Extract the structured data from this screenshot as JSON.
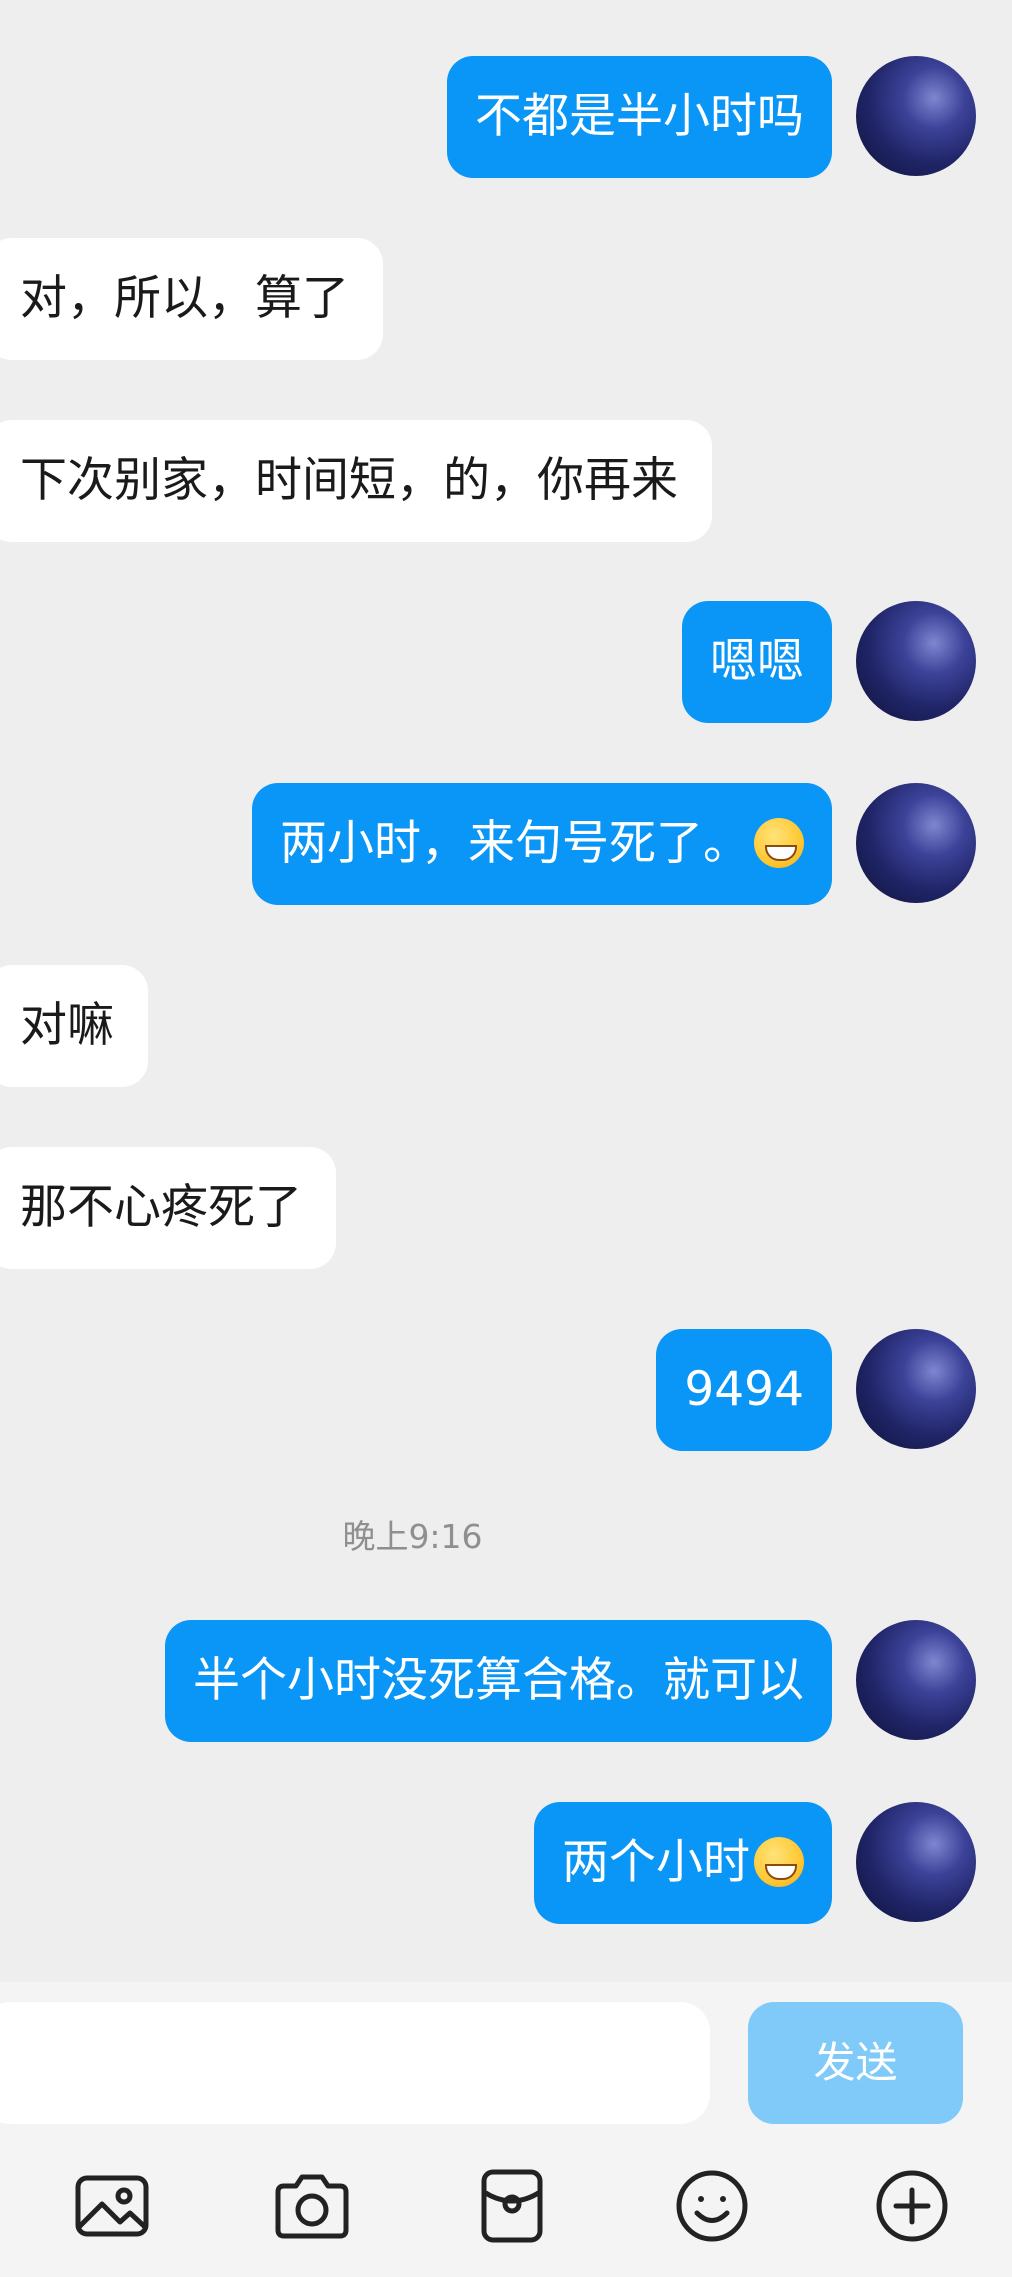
{
  "conversation": {
    "messages": [
      {
        "side": "out",
        "text": "不都是半小时吗"
      },
      {
        "side": "in",
        "text": "对，所以，算了"
      },
      {
        "side": "in",
        "text": "下次别家，时间短，的，你再来"
      },
      {
        "side": "out",
        "text": "嗯嗯"
      },
      {
        "side": "out",
        "text": "两小时，来句号死了。",
        "emoji": "tears-of-joy-emoji"
      },
      {
        "side": "in",
        "text": "对嘛"
      },
      {
        "side": "in",
        "text": "那不心疼死了"
      },
      {
        "side": "out",
        "text": "9494"
      },
      {
        "side": "out",
        "text": "半个小时没死算合格。就可以"
      },
      {
        "side": "out",
        "text": "两个小时",
        "emoji": "grinning-face-emoji"
      }
    ],
    "timestamp": "晚上9:16"
  },
  "input_bar": {
    "input_value": "",
    "send_label": "发送"
  },
  "toolbar": {
    "icons": [
      "image-icon",
      "camera-icon",
      "red-packet-icon",
      "emoji-icon",
      "plus-icon"
    ]
  },
  "colors": {
    "outgoing_bubble": "#0a96f6",
    "incoming_bubble": "#ffffff",
    "send_button": "#7fcaf8",
    "background": "#eeeeee"
  }
}
